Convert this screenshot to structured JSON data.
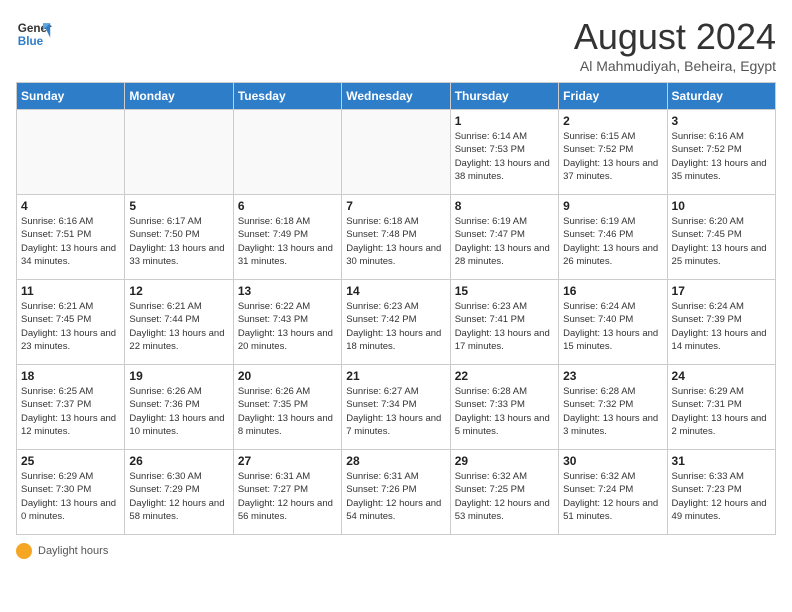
{
  "logo": {
    "line1": "General",
    "line2": "Blue"
  },
  "title": "August 2024",
  "location": "Al Mahmudiyah, Beheira, Egypt",
  "days_of_week": [
    "Sunday",
    "Monday",
    "Tuesday",
    "Wednesday",
    "Thursday",
    "Friday",
    "Saturday"
  ],
  "weeks": [
    [
      {
        "day": "",
        "info": ""
      },
      {
        "day": "",
        "info": ""
      },
      {
        "day": "",
        "info": ""
      },
      {
        "day": "",
        "info": ""
      },
      {
        "day": "1",
        "info": "Sunrise: 6:14 AM\nSunset: 7:53 PM\nDaylight: 13 hours and 38 minutes."
      },
      {
        "day": "2",
        "info": "Sunrise: 6:15 AM\nSunset: 7:52 PM\nDaylight: 13 hours and 37 minutes."
      },
      {
        "day": "3",
        "info": "Sunrise: 6:16 AM\nSunset: 7:52 PM\nDaylight: 13 hours and 35 minutes."
      }
    ],
    [
      {
        "day": "4",
        "info": "Sunrise: 6:16 AM\nSunset: 7:51 PM\nDaylight: 13 hours and 34 minutes."
      },
      {
        "day": "5",
        "info": "Sunrise: 6:17 AM\nSunset: 7:50 PM\nDaylight: 13 hours and 33 minutes."
      },
      {
        "day": "6",
        "info": "Sunrise: 6:18 AM\nSunset: 7:49 PM\nDaylight: 13 hours and 31 minutes."
      },
      {
        "day": "7",
        "info": "Sunrise: 6:18 AM\nSunset: 7:48 PM\nDaylight: 13 hours and 30 minutes."
      },
      {
        "day": "8",
        "info": "Sunrise: 6:19 AM\nSunset: 7:47 PM\nDaylight: 13 hours and 28 minutes."
      },
      {
        "day": "9",
        "info": "Sunrise: 6:19 AM\nSunset: 7:46 PM\nDaylight: 13 hours and 26 minutes."
      },
      {
        "day": "10",
        "info": "Sunrise: 6:20 AM\nSunset: 7:45 PM\nDaylight: 13 hours and 25 minutes."
      }
    ],
    [
      {
        "day": "11",
        "info": "Sunrise: 6:21 AM\nSunset: 7:45 PM\nDaylight: 13 hours and 23 minutes."
      },
      {
        "day": "12",
        "info": "Sunrise: 6:21 AM\nSunset: 7:44 PM\nDaylight: 13 hours and 22 minutes."
      },
      {
        "day": "13",
        "info": "Sunrise: 6:22 AM\nSunset: 7:43 PM\nDaylight: 13 hours and 20 minutes."
      },
      {
        "day": "14",
        "info": "Sunrise: 6:23 AM\nSunset: 7:42 PM\nDaylight: 13 hours and 18 minutes."
      },
      {
        "day": "15",
        "info": "Sunrise: 6:23 AM\nSunset: 7:41 PM\nDaylight: 13 hours and 17 minutes."
      },
      {
        "day": "16",
        "info": "Sunrise: 6:24 AM\nSunset: 7:40 PM\nDaylight: 13 hours and 15 minutes."
      },
      {
        "day": "17",
        "info": "Sunrise: 6:24 AM\nSunset: 7:39 PM\nDaylight: 13 hours and 14 minutes."
      }
    ],
    [
      {
        "day": "18",
        "info": "Sunrise: 6:25 AM\nSunset: 7:37 PM\nDaylight: 13 hours and 12 minutes."
      },
      {
        "day": "19",
        "info": "Sunrise: 6:26 AM\nSunset: 7:36 PM\nDaylight: 13 hours and 10 minutes."
      },
      {
        "day": "20",
        "info": "Sunrise: 6:26 AM\nSunset: 7:35 PM\nDaylight: 13 hours and 8 minutes."
      },
      {
        "day": "21",
        "info": "Sunrise: 6:27 AM\nSunset: 7:34 PM\nDaylight: 13 hours and 7 minutes."
      },
      {
        "day": "22",
        "info": "Sunrise: 6:28 AM\nSunset: 7:33 PM\nDaylight: 13 hours and 5 minutes."
      },
      {
        "day": "23",
        "info": "Sunrise: 6:28 AM\nSunset: 7:32 PM\nDaylight: 13 hours and 3 minutes."
      },
      {
        "day": "24",
        "info": "Sunrise: 6:29 AM\nSunset: 7:31 PM\nDaylight: 13 hours and 2 minutes."
      }
    ],
    [
      {
        "day": "25",
        "info": "Sunrise: 6:29 AM\nSunset: 7:30 PM\nDaylight: 13 hours and 0 minutes."
      },
      {
        "day": "26",
        "info": "Sunrise: 6:30 AM\nSunset: 7:29 PM\nDaylight: 12 hours and 58 minutes."
      },
      {
        "day": "27",
        "info": "Sunrise: 6:31 AM\nSunset: 7:27 PM\nDaylight: 12 hours and 56 minutes."
      },
      {
        "day": "28",
        "info": "Sunrise: 6:31 AM\nSunset: 7:26 PM\nDaylight: 12 hours and 54 minutes."
      },
      {
        "day": "29",
        "info": "Sunrise: 6:32 AM\nSunset: 7:25 PM\nDaylight: 12 hours and 53 minutes."
      },
      {
        "day": "30",
        "info": "Sunrise: 6:32 AM\nSunset: 7:24 PM\nDaylight: 12 hours and 51 minutes."
      },
      {
        "day": "31",
        "info": "Sunrise: 6:33 AM\nSunset: 7:23 PM\nDaylight: 12 hours and 49 minutes."
      }
    ]
  ],
  "footer": {
    "daylight_label": "Daylight hours"
  }
}
